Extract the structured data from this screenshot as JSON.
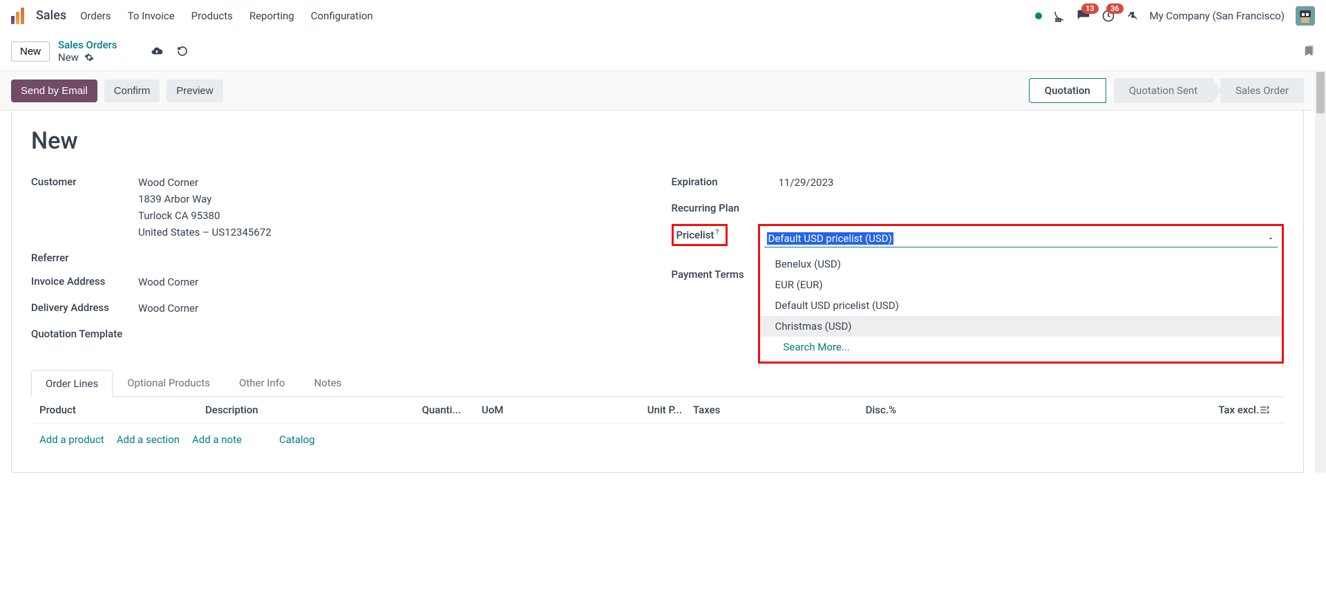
{
  "topbar": {
    "app_name": "Sales",
    "nav": [
      "Orders",
      "To Invoice",
      "Products",
      "Reporting",
      "Configuration"
    ],
    "chat_badge": "13",
    "activity_badge": "36",
    "company": "My Company (San Francisco)"
  },
  "breadcrumb": {
    "new_btn": "New",
    "link": "Sales Orders",
    "current": "New"
  },
  "actions": {
    "send_email": "Send by Email",
    "confirm": "Confirm",
    "preview": "Preview"
  },
  "status": {
    "steps": [
      "Quotation",
      "Quotation Sent",
      "Sales Order"
    ]
  },
  "record": {
    "title": "New",
    "left": {
      "customer_label": "Customer",
      "customer_name": "Wood Corner",
      "customer_street": "1839 Arbor Way",
      "customer_city": "Turlock CA 95380",
      "customer_country": "United States – US12345672",
      "referrer_label": "Referrer",
      "invoice_addr_label": "Invoice Address",
      "invoice_addr": "Wood Corner",
      "delivery_addr_label": "Delivery Address",
      "delivery_addr": "Wood Corner",
      "quote_tpl_label": "Quotation Template"
    },
    "right": {
      "expiration_label": "Expiration",
      "expiration": "11/29/2023",
      "recurring_label": "Recurring Plan",
      "pricelist_label": "Pricelist",
      "pricelist_value": "Default USD pricelist (USD)",
      "pricelist_options": [
        "Benelux (USD)",
        "EUR (EUR)",
        "Default USD pricelist (USD)",
        "Christmas (USD)"
      ],
      "pricelist_search_more": "Search More...",
      "payment_terms_label": "Payment Terms"
    }
  },
  "tabs": [
    "Order Lines",
    "Optional Products",
    "Other Info",
    "Notes"
  ],
  "table": {
    "headers": {
      "product": "Product",
      "description": "Description",
      "qty": "Quanti...",
      "uom": "UoM",
      "price": "Unit P...",
      "taxes": "Taxes",
      "disc": "Disc.%",
      "taxexcl": "Tax excl."
    },
    "actions": {
      "add_product": "Add a product",
      "add_section": "Add a section",
      "add_note": "Add a note",
      "catalog": "Catalog"
    }
  }
}
